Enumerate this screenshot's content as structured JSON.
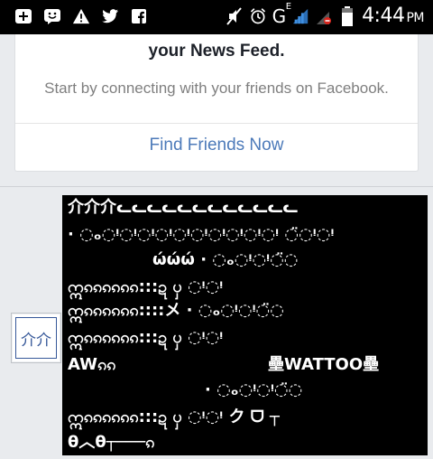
{
  "status_bar": {
    "time": "4:44",
    "ampm": "PM",
    "network": "G",
    "network_sup": "E",
    "notification_icons": [
      "plus-box-icon",
      "messenger-face-icon",
      "warning-icon",
      "twitter-icon",
      "facebook-icon"
    ],
    "system_icons": [
      "mute-icon",
      "alarm-icon",
      "signal-icon",
      "no-sim-icon",
      "battery-icon"
    ]
  },
  "feed_card": {
    "title": "your News Feed.",
    "subtitle": "Start by connecting with your friends on Facebook.",
    "link_label": "Find Friends Now",
    "link_color": "#4c7ab9"
  },
  "avatar": {
    "text": "介介"
  },
  "post": {
    "background": "#000000",
    "lines": [
      "介介介ᓚᓚᓚᓚᓚᓚᓚᓚᓚᓚᓚᓚ",
      "· ◌ₒ◌ᵎ◌ᵎ◌ᵎ◌ᵎ◌ᵎ◌ᵎ◌ᵎ◌ᵎ◌ᵎ◌ᵎ ◌̈◌ᵎ◌ᵎ",
      "ώώώ · ◌ₒ◌ᵎ◌ᵎ◌̈◌",
      "ဣၵၵၵၵၵၵ:::ဍ ၦ ◌ᵎ◌ᵎ",
      "ဣၵၵၵၵၵၵ::::メ · ◌ₒ◌ᵎ◌ᵎ◌̈◌",
      "ဣၵၵၵၵၵၵ:::ဍ ၦ ◌ᵎ◌ᵎ",
      "AWၵၵ",
      "壘WATTOO壘",
      "· ◌ₒ◌ᵎ◌ᵎ◌̈◌",
      "ဣၵၵၵၵၵၵ:::ဍ ၦ ◌ᵎ◌ᵎ   ク ᗜ ┬",
      "θ︿θ┬───ၵ"
    ]
  }
}
